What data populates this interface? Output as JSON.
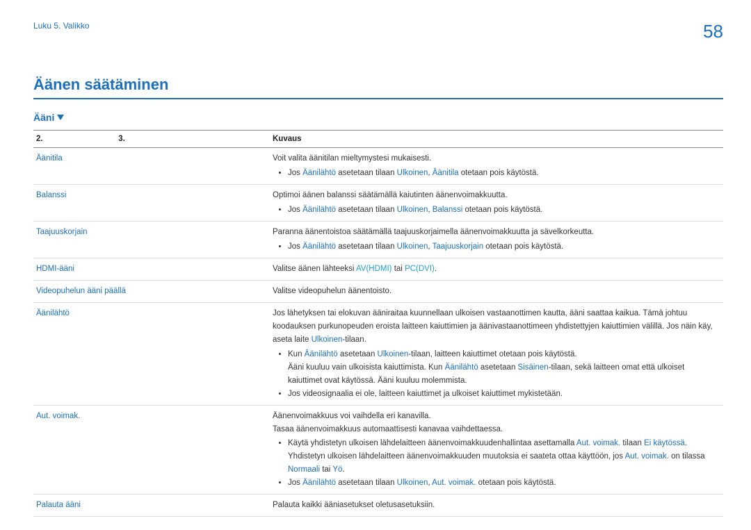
{
  "header": {
    "chapter": "Luku 5. Valikko",
    "page_number": "58"
  },
  "section": {
    "title": "Äänen säätäminen",
    "sub": "Ääni"
  },
  "table": {
    "headers": {
      "c1": "2.",
      "c2": "3.",
      "c3": "Kuvaus"
    },
    "rows": {
      "aanitila": {
        "label": "Äänitila",
        "line1": "Voit valita äänitilan mieltymystesi mukaisesti.",
        "b1_pre": "Jos ",
        "b1_k1": "Äänilähtö",
        "b1_mid1": " asetetaan tilaan ",
        "b1_k2": "Ulkoinen",
        "b1_mid2": ", ",
        "b1_k3": "Äänitila",
        "b1_post": " otetaan pois käytöstä."
      },
      "balanssi": {
        "label": "Balanssi",
        "line1": "Optimoi äänen balanssi säätämällä kaiutinten äänenvoimakkuutta.",
        "b1_pre": "Jos ",
        "b1_k1": "Äänilähtö",
        "b1_mid1": " asetetaan tilaan ",
        "b1_k2": "Ulkoinen",
        "b1_mid2": ", ",
        "b1_k3": "Balanssi",
        "b1_post": " otetaan pois käytöstä."
      },
      "taajuus": {
        "label": "Taajuuskorjain",
        "line1": "Paranna äänentoistoa säätämällä taajuuskorjaimella äänenvoimakkuutta ja sävelkorkeutta.",
        "b1_pre": "Jos ",
        "b1_k1": "Äänilähtö",
        "b1_mid1": " asetetaan tilaan ",
        "b1_k2": "Ulkoinen",
        "b1_mid2": ", ",
        "b1_k3": "Taajuuskorjain",
        "b1_post": " otetaan pois käytöstä."
      },
      "hdmi": {
        "label": "HDMI-ääni",
        "pre": "Valitse äänen lähteeksi ",
        "k1": "AV(HDMI)",
        "mid": " tai ",
        "k2": "PC(DVI)",
        "post": "."
      },
      "videopuhelu": {
        "label": "Videopuhelun ääni päällä",
        "line1": "Valitse videopuhelun äänentoisto."
      },
      "aanilahto": {
        "label": "Äänilähtö",
        "p1": "Jos lähetyksen tai elokuvan ääniraitaa kuunnellaan ulkoisen vastaanottimen kautta, ääni saattaa kaikua. Tämä johtuu koodauksen purkunopeuden eroista laitteen kaiuttimien ja äänivastaanottimeen yhdistettyjen kaiuttimien välillä. Jos näin käy, aseta laite ",
        "p1_k": "Ulkoinen",
        "p1_post": "-tilaan.",
        "b1_pre": "Kun ",
        "b1_k1": "Äänilähtö",
        "b1_mid1": " asetetaan ",
        "b1_k2": "Ulkoinen",
        "b1_post": "-tilaan, laitteen kaiuttimet otetaan pois käytöstä.",
        "b1_line2_pre": "Ääni kuuluu vain ulkoisista kaiuttimista. Kun ",
        "b1_line2_k1": "Äänilähtö",
        "b1_line2_mid": " asetetaan ",
        "b1_line2_k2": "Sisäinen",
        "b1_line2_post": "-tilaan, sekä laitteen omat että ulkoiset kaiuttimet ovat käytössä. Ääni kuuluu molemmista.",
        "b2": "Jos videosignaalia ei ole, laitteen kaiuttimet ja ulkoiset kaiuttimet mykistetään."
      },
      "autvoimak": {
        "label": "Aut. voimak.",
        "p1": "Äänenvoimakkuus voi vaihdella eri kanavilla.",
        "p2": "Tasaa äänenvoimakkuus automaattisesti kanavaa vaihdettaessa.",
        "b1_pre": "Käytä yhdistetyn ulkoisen lähdelaitteen äänenvoimakkuudenhallintaa asettamalla ",
        "b1_k1": "Aut. voimak.",
        "b1_mid1": " tilaan ",
        "b1_k2": "Ei käytössä",
        "b1_post1": ". Yhdistetyn ulkoisen lähdelaitteen äänenvoimakkuuden muutoksia ei saateta ottaa käyttöön, jos ",
        "b1_k3": "Aut. voimak.",
        "b1_mid2": " on tilassa ",
        "b1_k4": "Normaali",
        "b1_or": " tai ",
        "b1_k5": "Yö",
        "b1_end": ".",
        "b2_pre": "Jos ",
        "b2_k1": "Äänilähtö",
        "b2_mid1": " asetetaan tilaan ",
        "b2_k2": "Ulkoinen",
        "b2_mid2": ", ",
        "b2_k3": "Aut. voimak.",
        "b2_post": " otetaan pois käytöstä."
      },
      "palauta": {
        "label": "Palauta ääni",
        "line1": "Palauta kaikki ääniasetukset oletusasetuksiin."
      }
    }
  }
}
